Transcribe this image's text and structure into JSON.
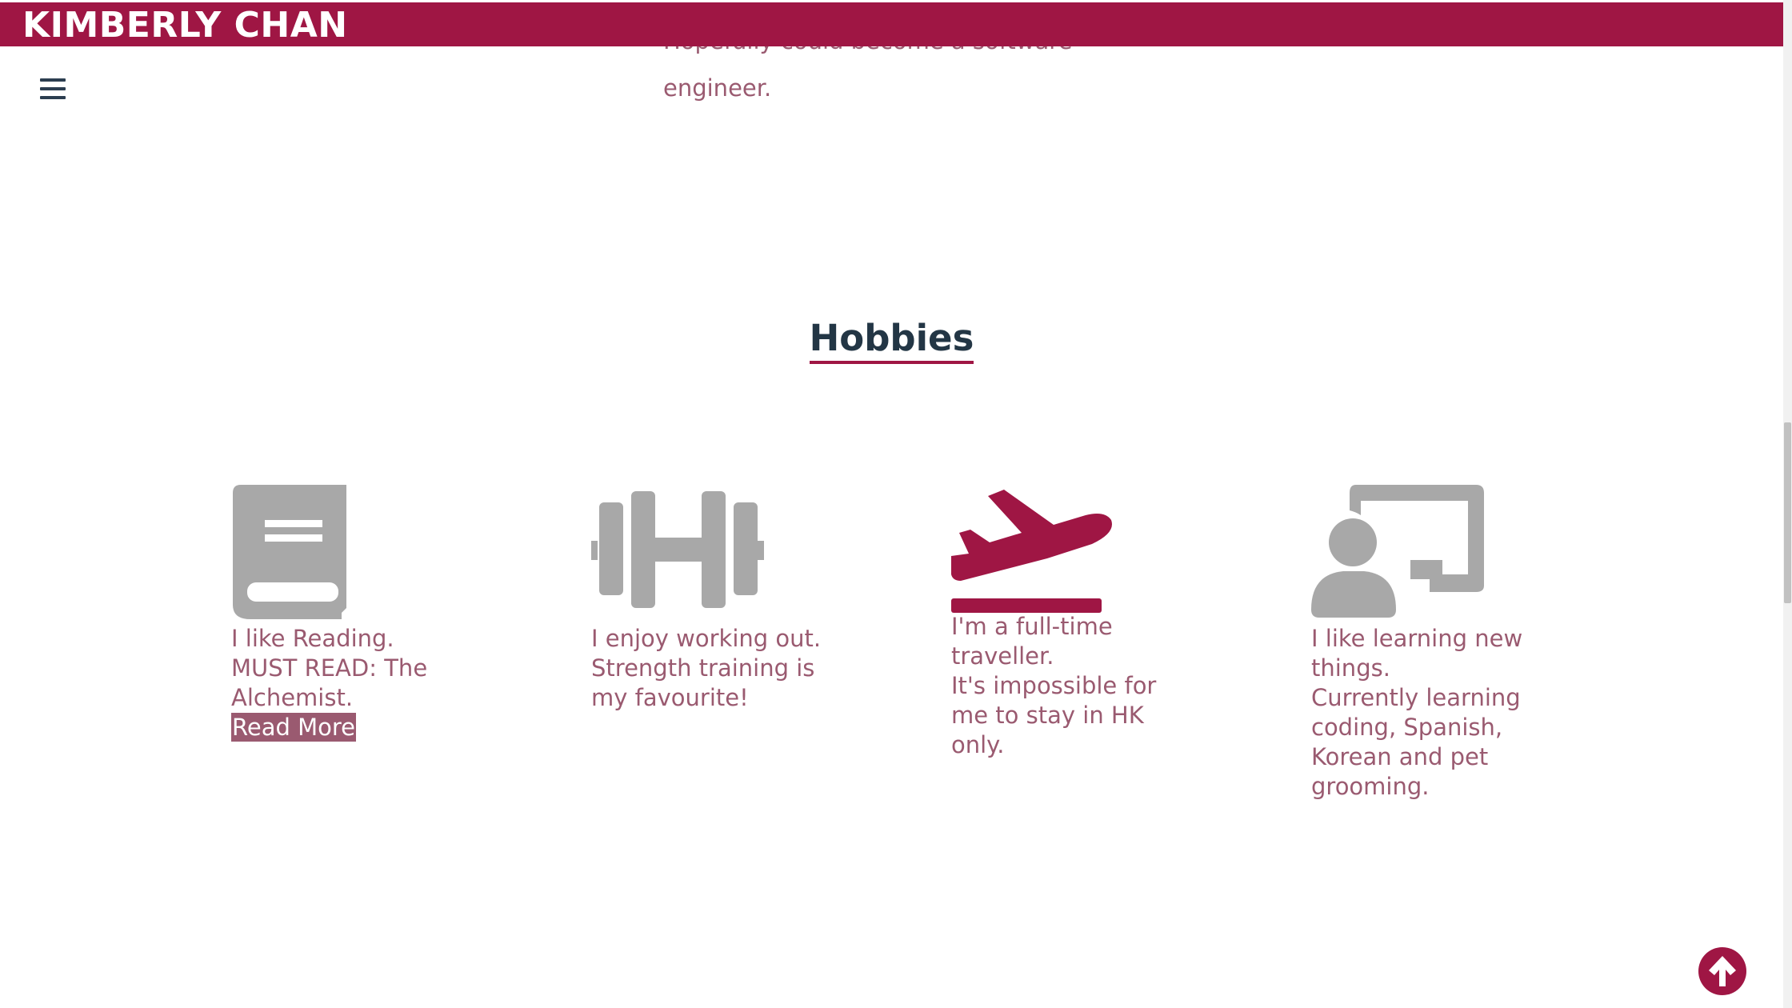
{
  "header": {
    "title": "KIMBERLY CHAN"
  },
  "intro": {
    "line1": "Hopefully could become a software",
    "line2": "engineer."
  },
  "hobbies": {
    "heading": "Hobbies",
    "items": [
      {
        "icon": "book-icon",
        "text": "I like Reading.\nMUST READ: The\nAlchemist.",
        "link": "Read More"
      },
      {
        "icon": "dumbbell-icon",
        "text": "I enjoy working out.\nStrength training is\nmy favourite!"
      },
      {
        "icon": "plane-departure-icon",
        "text": "I'm a full-time\ntraveller.\nIt's impossible for\nme to stay in HK\nonly."
      },
      {
        "icon": "chalkboard-teacher-icon",
        "text": "I like learning new\nthings.\nCurrently learning\ncoding, Spanish,\nKorean and pet\ngrooming."
      }
    ]
  },
  "colors": {
    "brand": "#9f1644",
    "text": "#9a5a70",
    "icon_gray": "#a8a8a8",
    "heading": "#233645"
  }
}
